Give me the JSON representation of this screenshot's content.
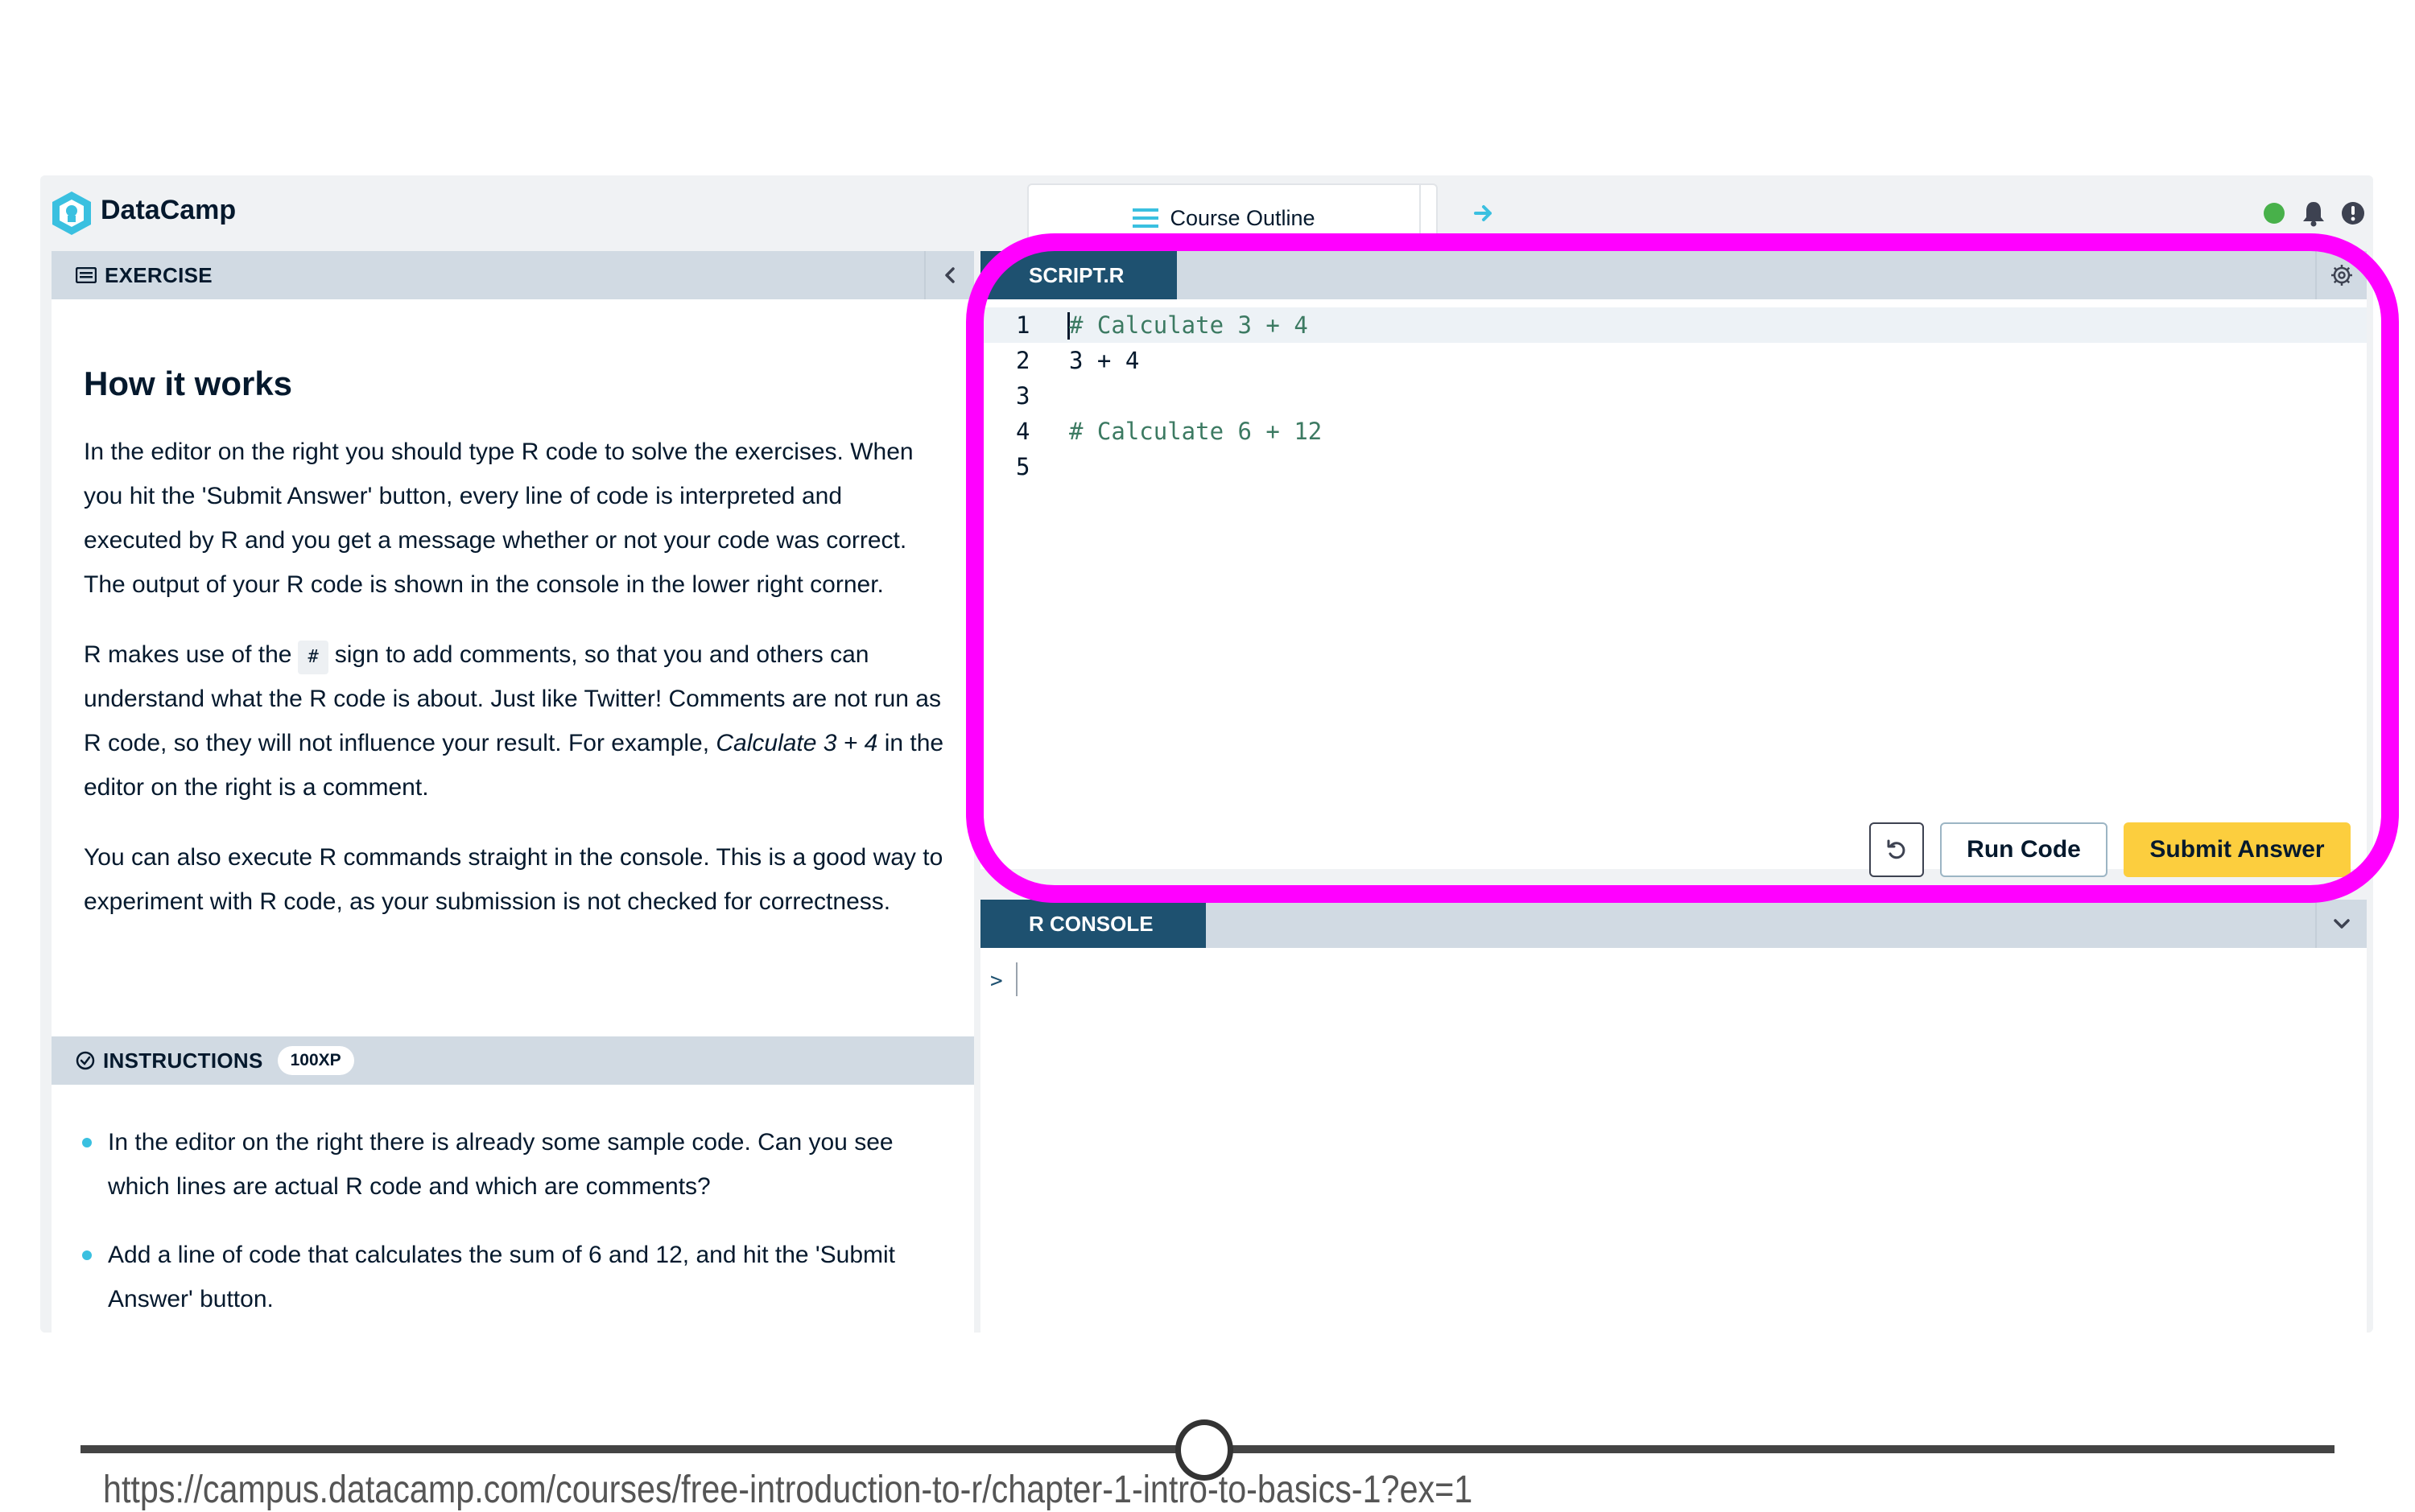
{
  "app": {
    "brand": "DataCamp",
    "brand_color": "#05192d",
    "course_outline_label": "Course Outline",
    "status_color": "#48b14a"
  },
  "exercise": {
    "section_label": "EXERCISE",
    "title": "How it works",
    "p1": "In the editor on the right you should type R code to solve the exercises. When you hit the 'Submit Answer' button, every line of code is interpreted and executed by R and you get a message whether or not your code was correct. The output of your R code is shown in the console in the lower right corner.",
    "p2_before": "R makes use of the",
    "p2_code": "#",
    "p2_after": "sign to add comments, so that you and others can understand what the R code is about. Just like Twitter! Comments are not run as R code, so they will not influence your result. For example,",
    "p2_italic": "Calculate 3 + 4",
    "p2_end": "in the editor on the right is a comment.",
    "p3": "You can also execute R commands straight in the console. This is a good way to experiment with R code, as your submission is not checked for correctness."
  },
  "instructions": {
    "section_label": "INSTRUCTIONS",
    "xp": "100XP",
    "items": [
      "In the editor on the right there is already some sample code. Can you see which lines are actual R code and which are comments?",
      "Add a line of code that calculates the sum of 6 and 12, and hit the 'Submit Answer' button."
    ]
  },
  "editor": {
    "file_tab": "SCRIPT.R",
    "lines": [
      {
        "num": "1",
        "text": "# Calculate 3 + 4"
      },
      {
        "num": "2",
        "text": "3 + 4"
      },
      {
        "num": "3",
        "text": ""
      },
      {
        "num": "4",
        "text": "# Calculate 6 + 12"
      },
      {
        "num": "5",
        "text": ""
      }
    ],
    "run_label": "Run Code",
    "submit_label": "Submit Answer",
    "accent_color": "#fcce3e"
  },
  "console": {
    "tab": "R CONSOLE",
    "prompt": ">"
  },
  "highlight_color": "#ff00ff",
  "url": "https://campus.datacamp.com/courses/free-introduction-to-r/chapter-1-intro-to-basics-1?ex=1"
}
